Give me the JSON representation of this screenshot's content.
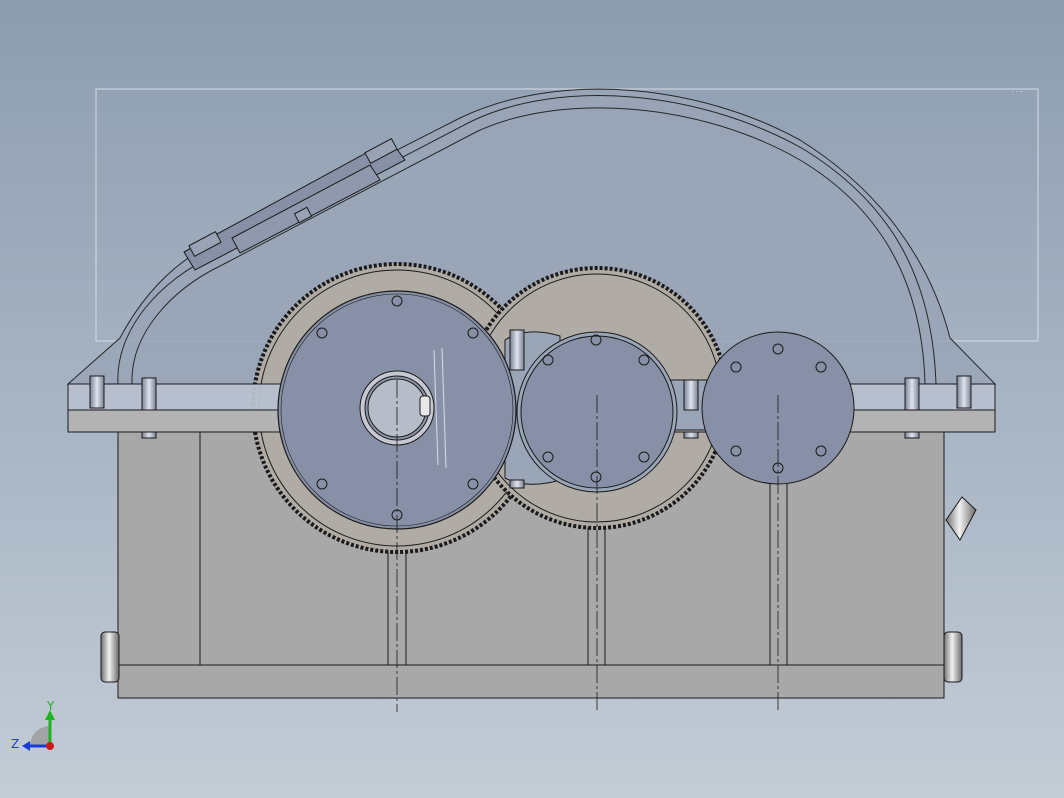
{
  "model_view": {
    "background_top": "#8d9cb0",
    "background_bottom": "#c4ccd6",
    "housing_color": "#a8a8a8",
    "cover_color": "#9aa6b8",
    "gear_disc_color": "#8790a6",
    "gear_teeth_color": "#b0aba4",
    "edge_color": "#1a1a1a"
  },
  "triad": {
    "y_label": "Y",
    "z_label": "Z",
    "y_color": "#1db51d",
    "z_color": "#1a3cd6",
    "origin_color": "#d01818"
  }
}
